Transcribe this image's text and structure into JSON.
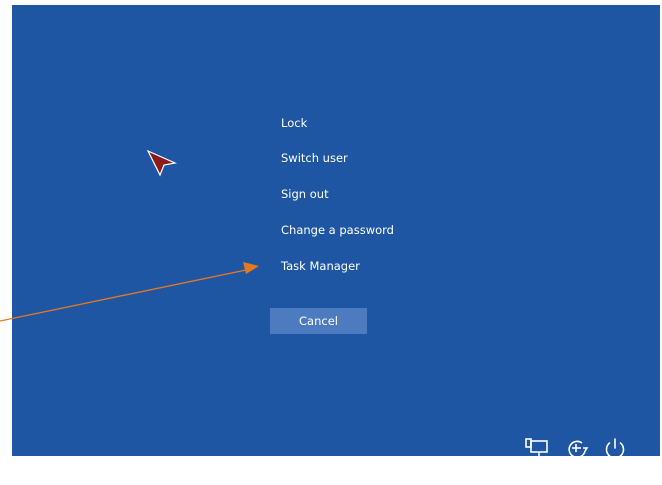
{
  "menu": {
    "items": [
      {
        "label": "Lock"
      },
      {
        "label": "Switch user"
      },
      {
        "label": "Sign out"
      },
      {
        "label": "Change a password"
      },
      {
        "label": "Task Manager"
      }
    ]
  },
  "cancel_label": "Cancel",
  "tray": {
    "icons": [
      "network-icon",
      "ease-of-access-icon",
      "power-icon"
    ]
  },
  "colors": {
    "background": "#1e56a3",
    "button": "#4d7bbf",
    "text": "#ffffff",
    "annotation": "#e8781e",
    "cursor": "#8b1a1a"
  }
}
